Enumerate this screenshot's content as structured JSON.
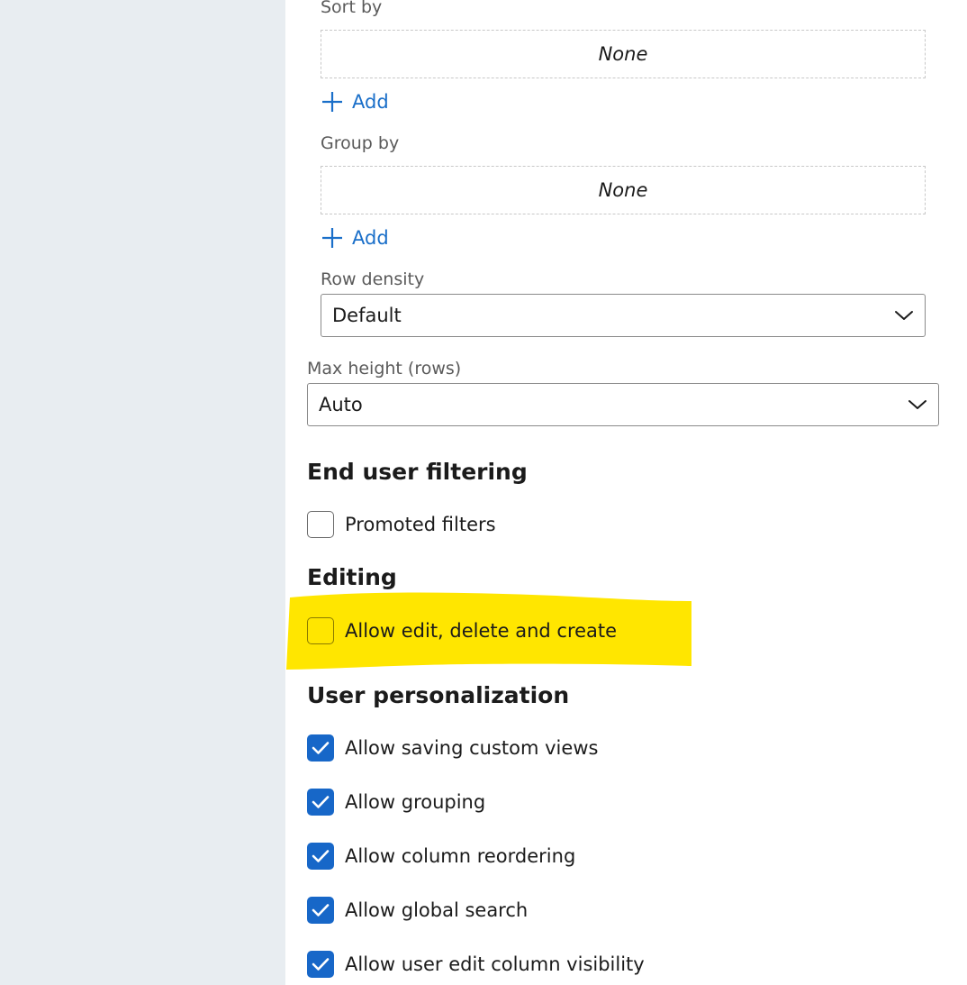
{
  "sort_by": {
    "label": "Sort by",
    "value": "None",
    "add_label": "Add"
  },
  "group_by": {
    "label": "Group by",
    "value": "None",
    "add_label": "Add"
  },
  "row_density": {
    "label": "Row density",
    "value": "Default"
  },
  "max_height": {
    "label": "Max height (rows)",
    "value": "Auto"
  },
  "end_user_filtering": {
    "title": "End user filtering",
    "promoted_filters": {
      "label": "Promoted filters",
      "checked": false
    }
  },
  "editing": {
    "title": "Editing",
    "allow_edit": {
      "label": "Allow edit, delete and create",
      "checked": false
    }
  },
  "user_personalization": {
    "title": "User personalization",
    "items": [
      {
        "label": "Allow saving custom views",
        "checked": true
      },
      {
        "label": "Allow grouping",
        "checked": true
      },
      {
        "label": "Allow column reordering",
        "checked": true
      },
      {
        "label": "Allow global search",
        "checked": true
      },
      {
        "label": "Allow user edit column visibility",
        "checked": true
      }
    ]
  },
  "colors": {
    "accent": "#1767c8",
    "link": "#1a6fc9",
    "highlight": "#ffe600",
    "left_pane": "#e8edf1"
  }
}
